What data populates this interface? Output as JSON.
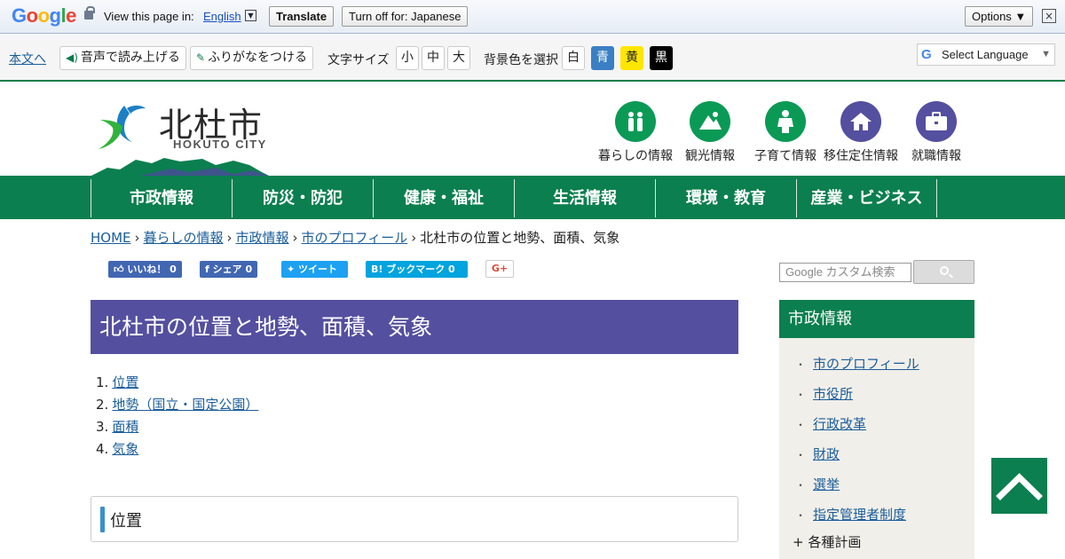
{
  "translate_bar": {
    "logo": [
      "G",
      "o",
      "o",
      "g",
      "l",
      "e"
    ],
    "view_text": "View this page in:",
    "language": "English",
    "translate_label": "Translate",
    "turn_off_label": "Turn off for: Japanese",
    "options_label": "Options ▼",
    "close_icon": "×"
  },
  "toolbar": {
    "skip_link": "本文へ",
    "read_aloud": "音声で読み上げる",
    "furigana": "ふりがなをつける",
    "font_size_label": "文字サイズ",
    "font_sizes": [
      "小",
      "中",
      "大"
    ],
    "bg_label": "背景色を選択",
    "bg_options": [
      {
        "label": "白",
        "bg": "#ffffff",
        "fg": "#222222"
      },
      {
        "label": "青",
        "bg": "#3a7fc4",
        "fg": "#ffffff"
      },
      {
        "label": "黄",
        "bg": "#ffe600",
        "fg": "#222222"
      },
      {
        "label": "黒",
        "bg": "#000000",
        "fg": "#ffffff"
      }
    ],
    "select_language": "Select Language"
  },
  "header": {
    "city_name": "北杜市",
    "city_name_en": "HOKUTO CITY",
    "nav_icons": [
      {
        "label": "暮らしの情報",
        "icon": "family-icon",
        "color": "#0a9a55"
      },
      {
        "label": "観光情報",
        "icon": "mountain-icon",
        "color": "#0a9a55"
      },
      {
        "label": "子育て情報",
        "icon": "child-icon",
        "color": "#0a9a55"
      },
      {
        "label": "移住定住情報",
        "icon": "home-icon",
        "color": "#544f9f"
      },
      {
        "label": "就職情報",
        "icon": "briefcase-icon",
        "color": "#544f9f"
      }
    ]
  },
  "main_nav": [
    "市政情報",
    "防災・防犯",
    "健康・福祉",
    "生活情報",
    "環境・教育",
    "産業・ビジネス"
  ],
  "breadcrumb": {
    "links": [
      "HOME",
      "暮らしの情報",
      "市政情報",
      "市のプロフィール"
    ],
    "current": "北杜市の位置と地勢、面積、気象"
  },
  "social": {
    "like": "いいね！ 0",
    "share": "シェア 0",
    "tweet": "ツイート",
    "bookmark": "B! ブックマーク  0",
    "gplus": "G+"
  },
  "page_title": "北杜市の位置と地勢、面積、気象",
  "toc": [
    "位置",
    "地勢（国立・国定公園）",
    "面積",
    "気象"
  ],
  "section_heading": "位置",
  "search": {
    "placeholder": "Google カスタム検索"
  },
  "sidebar": {
    "heading": "市政情報",
    "items": [
      "市のプロフィール",
      "市役所",
      "行政改革",
      "財政",
      "選挙",
      "指定管理者制度"
    ],
    "more": "+ 各種計画"
  },
  "colors": {
    "green": "#0b7f4f",
    "purple": "#544f9f"
  }
}
